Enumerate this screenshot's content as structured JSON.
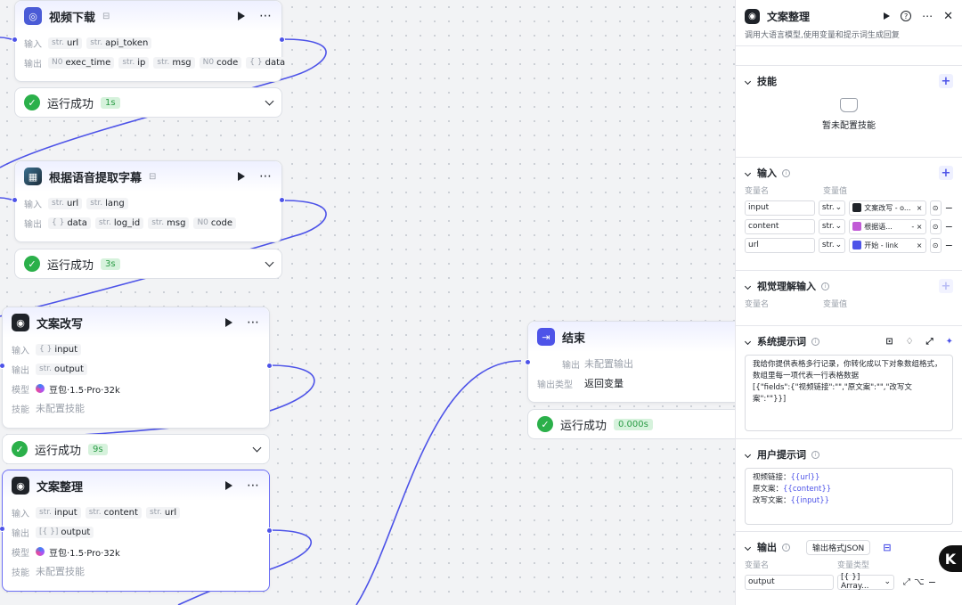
{
  "nodes": {
    "video": {
      "title": "视频下载",
      "inputs_label": "输入",
      "inputs": [
        {
          "type": "str.",
          "name": "url"
        },
        {
          "type": "str.",
          "name": "api_token"
        }
      ],
      "outputs_label": "输出",
      "outputs": [
        {
          "type": "N0",
          "name": "exec_time"
        },
        {
          "type": "str.",
          "name": "ip"
        },
        {
          "type": "str.",
          "name": "msg"
        },
        {
          "type": "N0",
          "name": "code"
        },
        {
          "type": "{ }",
          "name": "data"
        }
      ],
      "run_status": "运行成功",
      "run_time": "1s"
    },
    "subtitle": {
      "title": "根据语音提取字幕",
      "inputs_label": "输入",
      "inputs": [
        {
          "type": "str.",
          "name": "url"
        },
        {
          "type": "str.",
          "name": "lang"
        }
      ],
      "outputs_label": "输出",
      "outputs": [
        {
          "type": "{ }",
          "name": "data"
        },
        {
          "type": "str.",
          "name": "log_id"
        },
        {
          "type": "str.",
          "name": "msg"
        },
        {
          "type": "N0",
          "name": "code"
        }
      ],
      "run_status": "运行成功",
      "run_time": "3s"
    },
    "rewrite": {
      "title": "文案改写",
      "inputs_label": "输入",
      "inputs": [
        {
          "type": "{ }",
          "name": "input"
        }
      ],
      "outputs_label": "输出",
      "outputs": [
        {
          "type": "str.",
          "name": "output"
        }
      ],
      "model_label": "模型",
      "model": "豆包·1.5·Pro·32k",
      "skill_label": "技能",
      "skill": "未配置技能",
      "run_status": "运行成功",
      "run_time": "9s"
    },
    "organize": {
      "title": "文案整理",
      "inputs_label": "输入",
      "inputs": [
        {
          "type": "str.",
          "name": "input"
        },
        {
          "type": "str.",
          "name": "content"
        },
        {
          "type": "str.",
          "name": "url"
        }
      ],
      "outputs_label": "输出",
      "outputs": [
        {
          "type": "[{ }]",
          "name": "output"
        }
      ],
      "model_label": "模型",
      "model": "豆包·1.5·Pro·32k",
      "skill_label": "技能",
      "skill": "未配置技能"
    },
    "end": {
      "title": "结束",
      "output_label": "输出",
      "output_value": "未配置输出",
      "output_type_label": "输出类型",
      "output_type_value": "返回变量",
      "run_status": "运行成功",
      "run_time": "0.000s"
    }
  },
  "panel": {
    "title": "文案整理",
    "description": "调用大语言模型,使用变量和提示词生成回复",
    "skills": {
      "label": "技能",
      "empty": "暂未配置技能"
    },
    "inputs": {
      "label": "输入",
      "col_name": "变量名",
      "col_value": "变量值",
      "rows": [
        {
          "name": "input",
          "type": "str.",
          "ref": "文案改写 - o..."
        },
        {
          "name": "content",
          "type": "str.",
          "ref": "根据语..."
        },
        {
          "name": "url",
          "type": "str.",
          "ref": "开始 - link"
        }
      ]
    },
    "vision": {
      "label": "视觉理解输入",
      "col_name": "变量名",
      "col_value": "变量值"
    },
    "system_prompt": {
      "label": "系统提示词",
      "text": "我给你提供表格多行记录，你转化成以下对象数组格式，数组里每一项代表一行表格数据\n[{\"fields\":{\"视频链接\":\"\",\"原文案\":\"\",\"改写文案\":\"\"}}]"
    },
    "user_prompt": {
      "label": "用户提示词",
      "lines": [
        {
          "prefix": "视频链接：",
          "var": "{{url}}"
        },
        {
          "prefix": "原文案：",
          "var": "{{content}}"
        },
        {
          "prefix": "改写文案：",
          "var": "{{input}}"
        }
      ]
    },
    "output": {
      "label": "输出",
      "format": "输出格式JSON",
      "col_name": "变量名",
      "col_type": "变量类型",
      "rows": [
        {
          "name": "output",
          "type": "[{ }] Array..."
        }
      ]
    }
  }
}
